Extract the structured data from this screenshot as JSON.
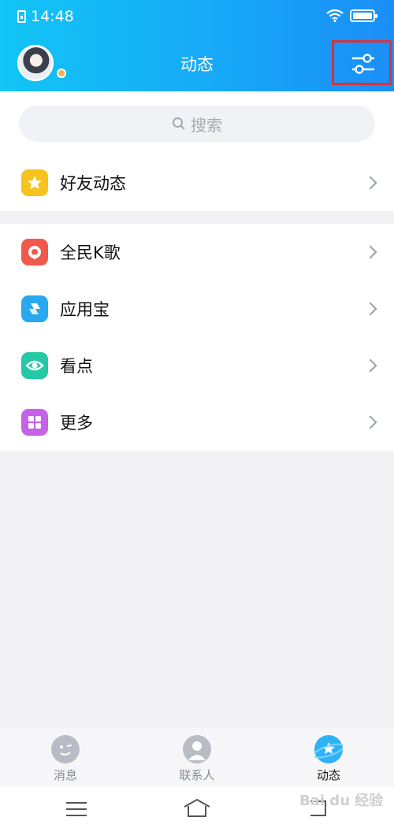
{
  "status_bar": {
    "time": "14:48"
  },
  "header": {
    "title": "动态"
  },
  "search": {
    "placeholder": "搜索"
  },
  "menu": {
    "group1": [
      {
        "label": "好友动态",
        "icon": "qzone-star-icon",
        "color": "#f6c31c"
      }
    ],
    "group2": [
      {
        "label": "全民K歌",
        "icon": "karaoke-icon",
        "color": "#f05a4c"
      },
      {
        "label": "应用宝",
        "icon": "app-store-icon",
        "color": "#29a8f0"
      },
      {
        "label": "看点",
        "icon": "eye-icon",
        "color": "#25c8a5"
      },
      {
        "label": "更多",
        "icon": "grid-icon",
        "color": "#c562e8"
      }
    ]
  },
  "tabs": [
    {
      "label": "消息",
      "icon": "message-face-icon"
    },
    {
      "label": "联系人",
      "icon": "contact-person-icon"
    },
    {
      "label": "动态",
      "icon": "planet-star-icon",
      "active": true
    }
  ],
  "watermark": "Bai du 经验",
  "colors": {
    "header_start": "#12c5f5",
    "header_end": "#1a8ef7",
    "highlight_box": "#d9323b"
  }
}
